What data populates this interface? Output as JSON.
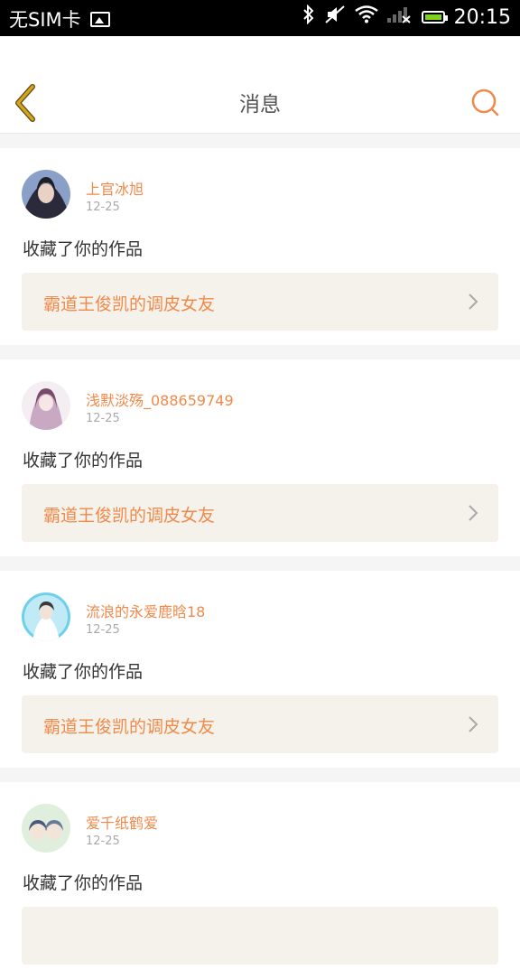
{
  "status": {
    "carrier": "无SIM卡",
    "time": "20:15"
  },
  "header": {
    "title": "消息",
    "back_icon": "chevron-left-icon",
    "search_icon": "search-icon"
  },
  "colors": {
    "accent": "#f08a4b",
    "back_chevron": "#d4a516",
    "card_work_bg": "#f4f2ea"
  },
  "messages": [
    {
      "username": "上官冰旭",
      "date": "12-25",
      "action": "收藏了你的作品",
      "work_title": "霸道王俊凯的调皮女友"
    },
    {
      "username": "浅默淡殇_088659749",
      "date": "12-25",
      "action": "收藏了你的作品",
      "work_title": "霸道王俊凯的调皮女友"
    },
    {
      "username": "流浪的永爱鹿晗18",
      "date": "12-25",
      "action": "收藏了你的作品",
      "work_title": "霸道王俊凯的调皮女友"
    },
    {
      "username": "爱千纸鹤爱",
      "date": "12-25",
      "action": "收藏了你的作品",
      "work_title": ""
    }
  ]
}
